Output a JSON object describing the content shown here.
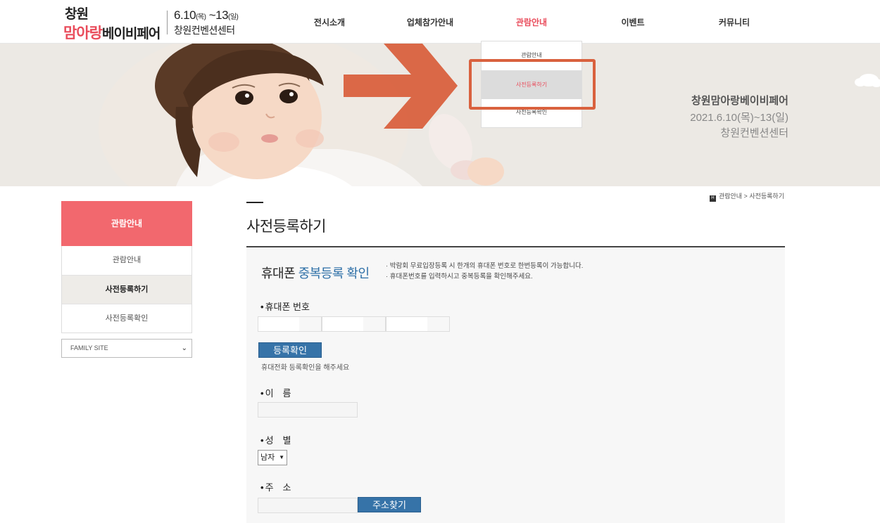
{
  "header": {
    "logo_top": "창원",
    "logo_accent": "맘아랑",
    "logo_rest": "베이비페어",
    "date_main": "6.10",
    "date_day1": "(목)",
    "date_sep": " ~13",
    "date_day2": "(일)",
    "venue": "창원컨벤션센터"
  },
  "nav": {
    "items": [
      "전시소개",
      "업체참가안내",
      "관람안내",
      "이벤트",
      "커뮤니티"
    ],
    "active": "관람안내"
  },
  "dropdown": {
    "items": [
      "관람안내",
      "사전등록하기",
      "사전등록확인"
    ],
    "selected": "사전등록하기"
  },
  "banner": {
    "title": "창원맘아랑베이비페어",
    "date": "2021.6.10(목)~13(일)",
    "venue": "창원컨벤션센터"
  },
  "sidebar": {
    "title": "관람안내",
    "items": [
      "관람안내",
      "사전등록하기",
      "사전등록확인"
    ],
    "selected": "사전등록하기",
    "family_site": "FAMILY SITE"
  },
  "breadcrumb": {
    "text": "관람안내 > 사전등록하기"
  },
  "page": {
    "title": "사전등록하기"
  },
  "form": {
    "heading_plain": "휴대폰 ",
    "heading_accent": "중복등록 확인",
    "notice_1": "· 박람회 무료입장등록 시 한개의 휴대폰 번호로 한번등록이 가능합니다.",
    "notice_2": "· 휴대폰번호를 입력하시고 중복등록을 확인해주세요.",
    "phone_label": "휴대폰 번호",
    "check_button": "등록확인",
    "check_hint": "휴대전화 등록확인을 해주세요",
    "name_label": "이　름",
    "gender_label": "성　별",
    "gender_value": "남자",
    "address_label": "주　소",
    "address_button": "주소찾기"
  }
}
